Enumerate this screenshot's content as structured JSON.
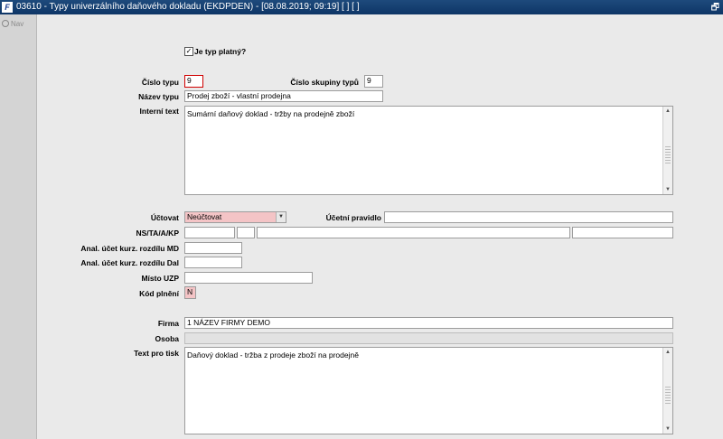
{
  "window": {
    "title": "03610 - Typy univerzálního daňového dokladu (EKDPDEN) - [08.08.2019; 09:19]  [ ]  [ ]",
    "app_icon": "F",
    "restore_icon": "🗗"
  },
  "sidebar": {
    "nav_label": "Nav"
  },
  "form": {
    "valid_checkbox": {
      "label": "Je typ platný?",
      "checked": true,
      "mark": "✓"
    },
    "cislo_typu": {
      "label": "Číslo typu",
      "value": "9"
    },
    "cislo_skupiny": {
      "label": "Číslo skupiny typů",
      "value": "9"
    },
    "nazev_typu": {
      "label": "Název typu",
      "value": "Prodej zboží - vlastní prodejna"
    },
    "interni_text": {
      "label": "Interní text",
      "value": "Sumární daňový doklad - tržby na prodejně zboží"
    },
    "uctovat": {
      "label": "Účtovat",
      "value": "Neúčtovat"
    },
    "ucetni_pravidlo": {
      "label": "Účetní pravidlo",
      "value": ""
    },
    "ns_ta_a_kp": {
      "label": "NS/TA/A/KP"
    },
    "anal_md": {
      "label": "Anal. účet kurz. rozdílu MD",
      "value": ""
    },
    "anal_dal": {
      "label": "Anal. účet kurz. rozdílu Dal",
      "value": ""
    },
    "misto_uzp": {
      "label": "Místo UZP",
      "value": ""
    },
    "kod_plneni": {
      "label": "Kód plnění",
      "value": "N"
    },
    "firma": {
      "label": "Firma",
      "value": "1 NÁZEV FIRMY DEMO"
    },
    "osoba": {
      "label": "Osoba",
      "value": ""
    },
    "text_pro_tisk": {
      "label": "Text pro tisk",
      "value": "Daňový doklad  - tržba z prodeje zboží na prodejně"
    }
  },
  "icons": {
    "scroll_up": "▲",
    "scroll_down": "▼",
    "dropdown": "▼"
  }
}
